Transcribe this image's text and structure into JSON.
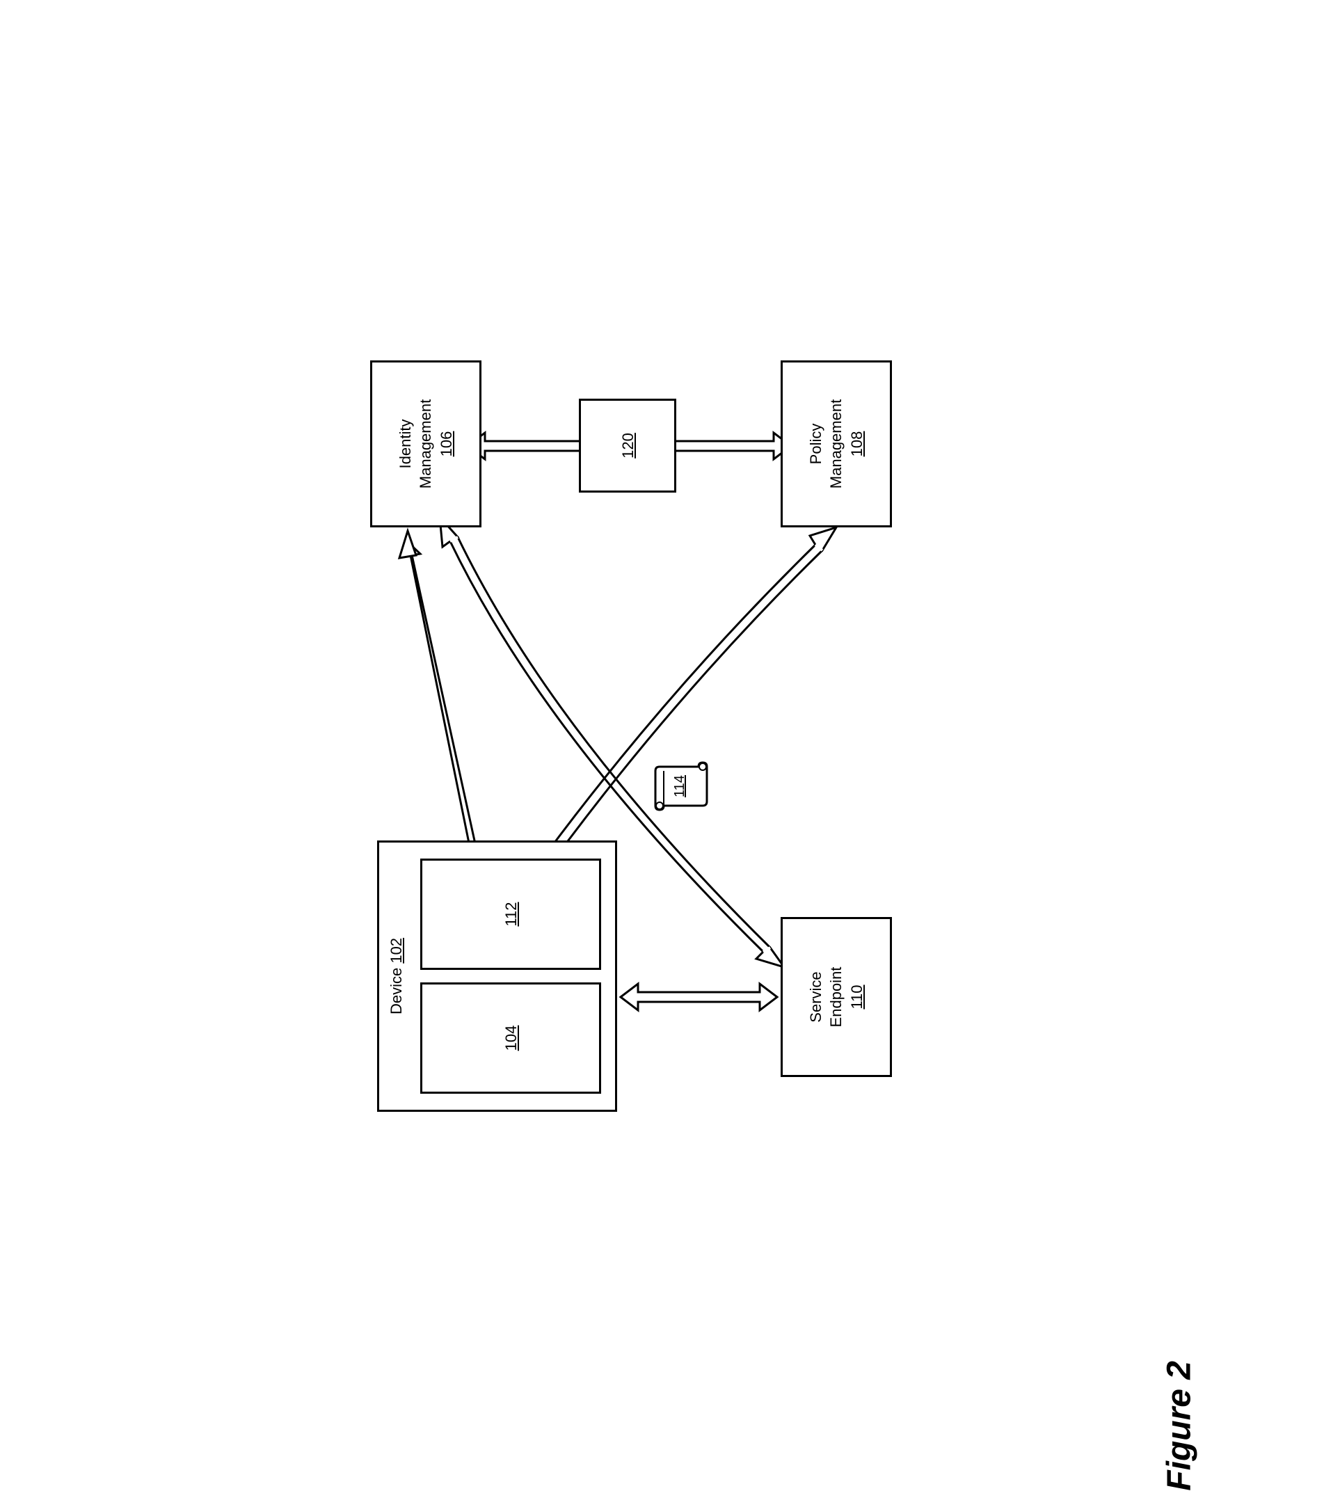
{
  "figure_label": "Figure 2",
  "boxes": {
    "device": {
      "label": "Device",
      "ref": "102"
    },
    "inner_104": {
      "ref": "104"
    },
    "inner_112": {
      "ref": "112"
    },
    "identity": {
      "label_line1": "Identity",
      "label_line2": "Management",
      "ref": "106"
    },
    "policy": {
      "label_line1": "Policy",
      "label_line2": "Management",
      "ref": "108"
    },
    "service": {
      "label_line1": "Service",
      "label_line2": "Endpoint",
      "ref": "110"
    },
    "middle_box": {
      "ref": "120"
    },
    "scroll": {
      "ref": "114"
    }
  }
}
